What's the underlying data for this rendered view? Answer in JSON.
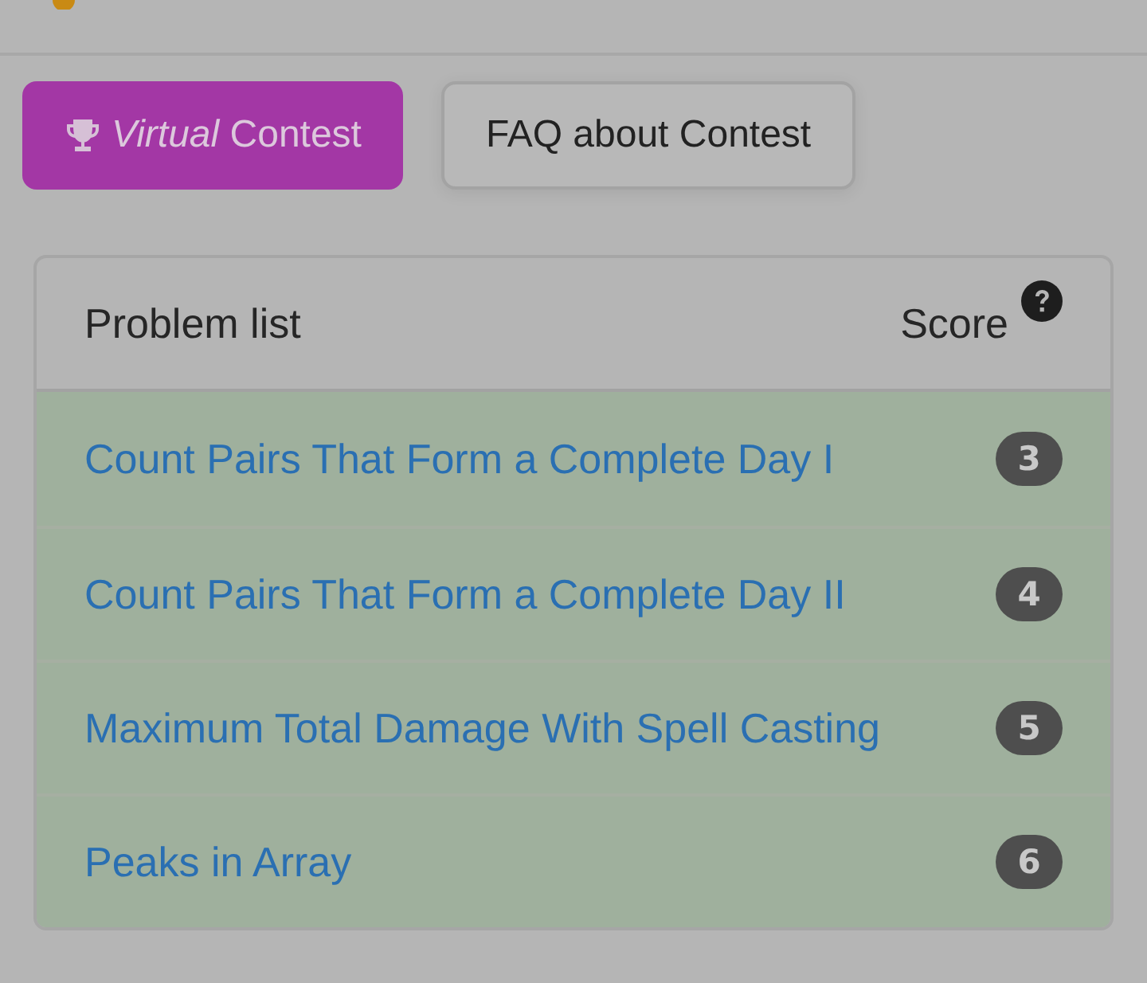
{
  "buttons": [
    {
      "label": "*Virtual* Contest",
      "kind": "primary"
    },
    {
      "label": "FAQ about Contest",
      "kind": "secondary"
    }
  ],
  "problem_list": {
    "title": "Problem list",
    "score_label": "Score",
    "rows": [
      {
        "title": "Count Pairs That Form a Complete Day I",
        "score": "3",
        "solved": true
      },
      {
        "title": "Count Pairs That Form a Complete Day II",
        "score": "4",
        "solved": true
      },
      {
        "title": "Maximum Total Damage With Spell Casting",
        "score": "5",
        "solved": true
      },
      {
        "title": "Peaks in Array",
        "score": "6",
        "solved": true
      }
    ]
  }
}
